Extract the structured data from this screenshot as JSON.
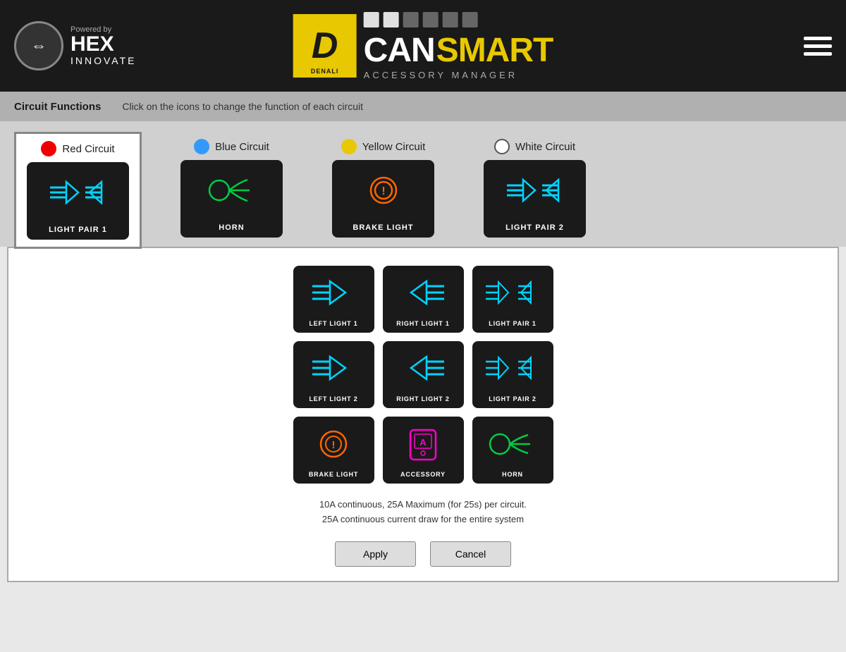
{
  "header": {
    "powered_by": "Powered by",
    "brand_hex": "HEX",
    "brand_innovate": "INNOVATE",
    "can": "CAN",
    "smart": "SMART",
    "accessory_manager": "ACCESSORY MANAGER",
    "denali": "DENALI"
  },
  "circuit_bar": {
    "title": "Circuit Functions",
    "instruction": "Click on the icons to change the function of each circuit"
  },
  "circuits": [
    {
      "id": "red",
      "label": "Red Circuit",
      "dot": "red",
      "active": true,
      "function": "LIGHT PAIR 1"
    },
    {
      "id": "blue",
      "label": "Blue Circuit",
      "dot": "blue",
      "active": false,
      "function": "HORN"
    },
    {
      "id": "yellow",
      "label": "Yellow Circuit",
      "dot": "yellow",
      "active": false,
      "function": "BRAKE LIGHT"
    },
    {
      "id": "white",
      "label": "White Circuit",
      "dot": "white",
      "active": false,
      "function": "LIGHT PAIR 2"
    }
  ],
  "grid_icons": [
    {
      "id": "left-light-1",
      "label": "LEFT LIGHT 1",
      "color": "cyan"
    },
    {
      "id": "right-light-1",
      "label": "RIGHT LIGHT 1",
      "color": "cyan"
    },
    {
      "id": "light-pair-1",
      "label": "LIGHT PAIR 1",
      "color": "cyan"
    },
    {
      "id": "left-light-2",
      "label": "LEFT LIGHT 2",
      "color": "cyan"
    },
    {
      "id": "right-light-2",
      "label": "RIGHT LIGHT 2",
      "color": "cyan"
    },
    {
      "id": "light-pair-2",
      "label": "LIGHT PAIR 2",
      "color": "cyan"
    },
    {
      "id": "brake-light",
      "label": "BRAKE LIGHT",
      "color": "orange"
    },
    {
      "id": "accessory",
      "label": "ACCESSORY",
      "color": "magenta"
    },
    {
      "id": "horn",
      "label": "HORN",
      "color": "green"
    }
  ],
  "info_line1": "10A continuous, 25A Maximum (for 25s) per circuit.",
  "info_line2": "25A continuous current  draw for the entire system",
  "buttons": {
    "apply": "Apply",
    "cancel": "Cancel"
  }
}
